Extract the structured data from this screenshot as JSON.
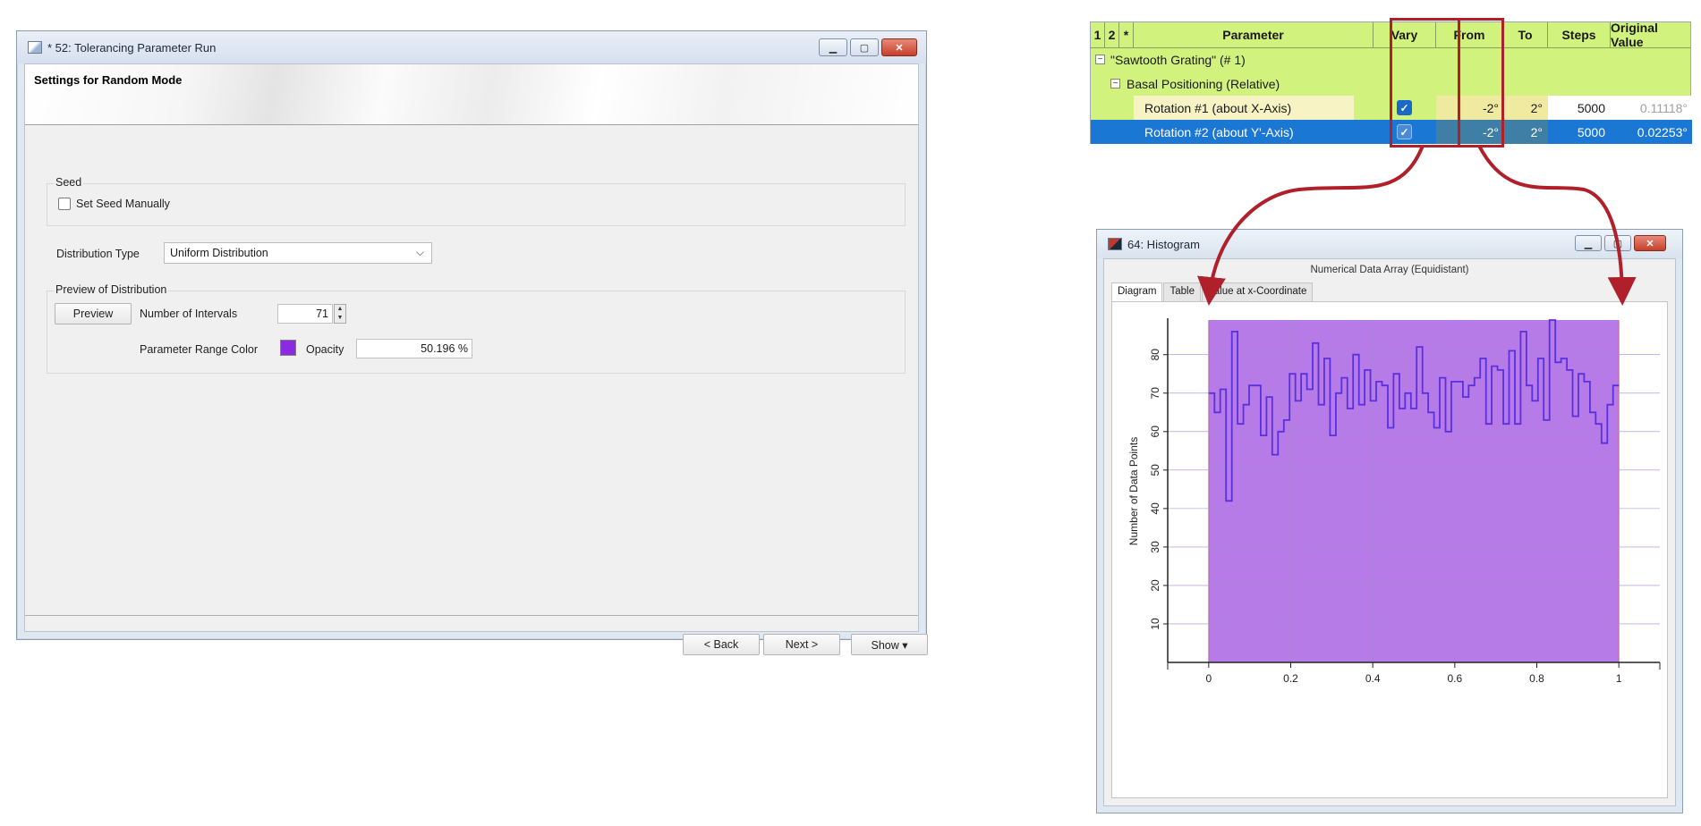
{
  "dialog": {
    "title": "* 52: Tolerancing Parameter Run",
    "header": "Settings for Random Mode",
    "seed_group": "Seed",
    "seed_checkbox": "Set Seed Manually",
    "distribution_label": "Distribution Type",
    "distribution_value": "Uniform Distribution",
    "preview_group": "Preview of Distribution",
    "preview_button": "Preview",
    "intervals_label": "Number of Intervals",
    "intervals_value": "71",
    "range_color_label": "Parameter Range Color",
    "range_color": "#8a2be2",
    "opacity_label": "Opacity",
    "opacity_value": "50.196 %",
    "back_button": "< Back",
    "next_button": "Next >",
    "show_button": "Show ▾"
  },
  "param_table": {
    "headers": [
      "1",
      "2",
      "*",
      "Parameter",
      "Vary",
      "From",
      "To",
      "Steps",
      "Original Value"
    ],
    "group_row": "\"Sawtooth Grating\" (# 1)",
    "sub_row": "Basal Positioning (Relative)",
    "rows": [
      {
        "name": "Rotation #1 (about X-Axis)",
        "vary": true,
        "from": "-2°",
        "to": "2°",
        "steps": "5000",
        "original": "0.11118°"
      },
      {
        "name": "Rotation #2 (about Y'-Axis)",
        "vary": true,
        "from": "-2°",
        "to": "2°",
        "steps": "5000",
        "original": "0.02253°"
      }
    ],
    "colors": {
      "header_bg": "#d2f27e",
      "highlight": "#f4f6b0",
      "selected": "#1a78d4",
      "red_frame": "#b0202a"
    }
  },
  "histogram_window": {
    "title": "64: Histogram",
    "subtitle": "Numerical Data Array (Equidistant)",
    "tabs": [
      "Diagram",
      "Table",
      "Value at x-Coordinate"
    ]
  },
  "chart_data": {
    "type": "histogram-step",
    "ylabel": "Number of Data Points",
    "xlabel": "",
    "xlim": [
      -0.1,
      1.1
    ],
    "ylim": [
      0,
      89
    ],
    "xticks": [
      "0",
      "0.2",
      "0.4",
      "0.6",
      "0.8",
      "1"
    ],
    "yticks": [
      "10",
      "20",
      "30",
      "40",
      "50",
      "60",
      "70",
      "80"
    ],
    "range_fill": "#b77be8",
    "line_color": "#5a2fe0",
    "bins": 71,
    "values": [
      70,
      65,
      71,
      42,
      86,
      62,
      67,
      72,
      72,
      59,
      69,
      54,
      60,
      63,
      75,
      68,
      75,
      71,
      83,
      67,
      79,
      59,
      70,
      74,
      66,
      80,
      67,
      76,
      68,
      73,
      72,
      61,
      75,
      66,
      70,
      66,
      82,
      70,
      65,
      61,
      74,
      60,
      73,
      73,
      69,
      72,
      74,
      79,
      62,
      77,
      76,
      62,
      81,
      62,
      86,
      72,
      68,
      79,
      63,
      89,
      78,
      79,
      76,
      64,
      75,
      73,
      65,
      62,
      57,
      67,
      72
    ]
  }
}
